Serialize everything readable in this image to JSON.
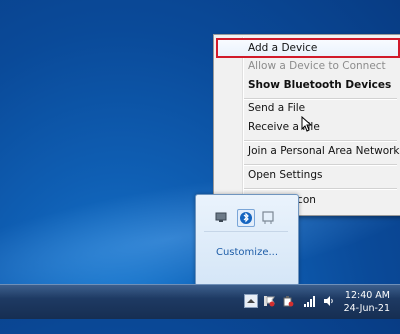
{
  "context_menu": {
    "items": [
      {
        "label": "Add a Device",
        "state": "highlighted"
      },
      {
        "label": "Allow a Device to Connect",
        "state": "disabled"
      },
      {
        "label": "Show Bluetooth Devices",
        "state": "bold"
      },
      {
        "label": "Send a File",
        "state": "normal"
      },
      {
        "label": "Receive a File",
        "state": "normal"
      },
      {
        "label": "Join a Personal Area Network",
        "state": "normal"
      },
      {
        "label": "Open Settings",
        "state": "normal"
      },
      {
        "label": "Remove Icon",
        "state": "normal"
      }
    ]
  },
  "tray_popup": {
    "customize_label": "Customize...",
    "icons": [
      "network-adapter-icon",
      "bluetooth-icon",
      "device-icon"
    ]
  },
  "taskbar": {
    "icons": [
      "show-hidden-icons-icon",
      "action-center-flag-icon",
      "power-icon",
      "network-signal-icon",
      "volume-icon"
    ],
    "clock": {
      "time": "12:40 AM",
      "date": "24-Jun-21"
    }
  },
  "colors": {
    "highlight_border": "#d11a2a",
    "desktop": "#0f5fb4",
    "link": "#1f5ea8"
  }
}
